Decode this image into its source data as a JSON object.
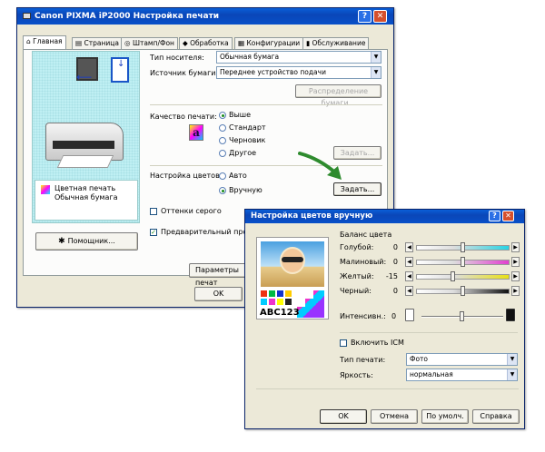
{
  "main_window": {
    "title": "Canon PIXMA iP2000 Настройка печати",
    "help_btn": "?",
    "close_btn": "✕",
    "tabs": [
      "Главная",
      "Страница",
      "Штамп/Фон",
      "Обработка",
      "Конфигурации",
      "Обслуживание"
    ],
    "preview_caption_1": "Цветная печать",
    "preview_caption_2": "Обычная бумага",
    "helper_button": "Помощник...",
    "media_type_label": "Тип носителя:",
    "media_type_value": "Обычная бумага",
    "paper_source_label": "Источник бумаги:",
    "paper_source_value": "Переднее устройство подачи",
    "paper_allocation_button": "Распределение бумаги...",
    "quality_label": "Качество печати:",
    "quality_options": [
      "Выше",
      "Стандарт",
      "Черновик",
      "Другое"
    ],
    "quality_set_button": "Задать...",
    "color_adjust_label": "Настройка цветов:",
    "color_options": [
      "Авто",
      "Вручную"
    ],
    "color_set_button": "Задать...",
    "grayscale_label": "Оттенки серого",
    "preview_check_label": "Предварительный просмо",
    "print_options_button": "Параметры печат",
    "ok_button": "OK"
  },
  "dialog": {
    "title": "Настройка цветов вручную",
    "help_btn": "?",
    "close_btn": "✕",
    "sample_text": "ABC123",
    "color_balance_label": "Баланс цвета",
    "sliders": [
      {
        "label": "Голубой:",
        "value": "0",
        "color": "#27d4e4",
        "level": 0.5
      },
      {
        "label": "Малиновый:",
        "value": "0",
        "color": "#e23fd0",
        "level": 0.5
      },
      {
        "label": "Желтый:",
        "value": "-15",
        "color": "#e8e016",
        "level": 0.4
      },
      {
        "label": "Черный:",
        "value": "0",
        "color": "#111111",
        "level": 0.5
      }
    ],
    "intensity_label": "Интенсивн.:",
    "intensity_value": "0",
    "intensity_level": 0.5,
    "icm_label": "Включить ICM",
    "print_type_label": "Тип печати:",
    "print_type_value": "Фото",
    "brightness_label": "Яркость:",
    "brightness_value": "нормальная",
    "ok_button": "OK",
    "cancel_button": "Отмена",
    "default_button": "По умолч.",
    "help_button": "Справка"
  },
  "colors": {
    "titlebar": "#0a50c8",
    "window": "#ece9d8",
    "arrow": "#2e8b2e",
    "preview_bg": "#bfeff3"
  }
}
